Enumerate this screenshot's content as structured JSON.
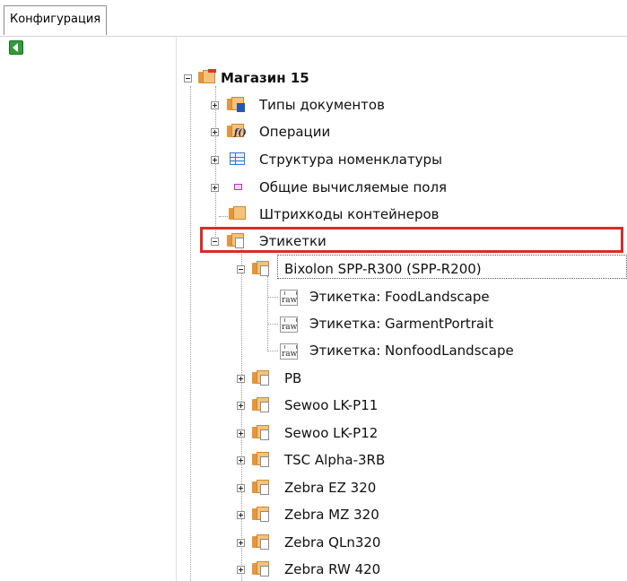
{
  "tab": {
    "label": "Конфигурация"
  },
  "toolbar": {
    "back_icon": "green-back-arrow-icon",
    "accent": "#2e9d3a"
  },
  "highlight_color": "#d92b2b",
  "tree": {
    "root": "Магазин 15",
    "children": [
      {
        "label": "Типы документов",
        "icon": "folder-doc-icon"
      },
      {
        "label": "Операции",
        "icon": "folder-fx-icon"
      },
      {
        "label": "Структура номенклатуры",
        "icon": "table-icon"
      },
      {
        "label": "Общие вычисляемые поля",
        "icon": "field-icon"
      },
      {
        "label": "Штрихкоды контейнеров",
        "icon": "folder-icon"
      },
      {
        "label": "Этикетки",
        "icon": "folder-icon"
      }
    ],
    "printers": [
      {
        "label": "Bixolon SPP-R300 (SPP-R200)"
      },
      {
        "label": "PB"
      },
      {
        "label": "Sewoo LK-P11"
      },
      {
        "label": "Sewoo LK-P12"
      },
      {
        "label": "TSC Alpha-3RB"
      },
      {
        "label": "Zebra EZ 320"
      },
      {
        "label": "Zebra MZ 320"
      },
      {
        "label": "Zebra QLn320"
      },
      {
        "label": "Zebra RW 420"
      }
    ],
    "labels": [
      {
        "label": "Этикетка: FoodLandscape",
        "icon": "raw-file-icon"
      },
      {
        "label": "Этикетка: GarmentPortrait",
        "icon": "raw-file-icon"
      },
      {
        "label": "Этикетка: NonfoodLandscape",
        "icon": "raw-file-icon"
      }
    ]
  }
}
